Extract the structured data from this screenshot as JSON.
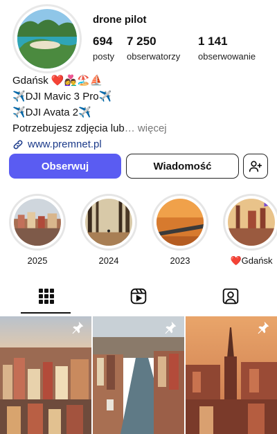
{
  "profile": {
    "username": "drone pilot",
    "avatar_icon": "avatar-photo",
    "stats": [
      {
        "value": "694",
        "label": "posty"
      },
      {
        "value": "7 250",
        "label": "obserwatorzy"
      },
      {
        "value": "1 141",
        "label": "obserwowanie"
      }
    ]
  },
  "bio": {
    "line1": "Gdańsk ❤️👩‍❤️‍👨🏖️⛵",
    "line2": "✈️DJI Mavic 3 Pro✈️",
    "line3": "✈️DJI Avata 2✈️",
    "line4": "Potrzebujesz zdjęcia lub",
    "more": "… więcej",
    "link": "www.premnet.pl"
  },
  "buttons": {
    "follow": "Obserwuj",
    "message": "Wiadomość",
    "add_user_icon": "add-user-icon"
  },
  "highlights": [
    {
      "label": "2025"
    },
    {
      "label": "2024"
    },
    {
      "label": "2023"
    },
    {
      "label": "❤️Gdańsk"
    }
  ],
  "tabs": {
    "posts_icon": "grid-icon",
    "reels_icon": "reels-icon",
    "tagged_icon": "tagged-icon"
  },
  "colors": {
    "accent": "#5a5cf2",
    "link": "#1b3a8a",
    "muted": "#777777"
  }
}
